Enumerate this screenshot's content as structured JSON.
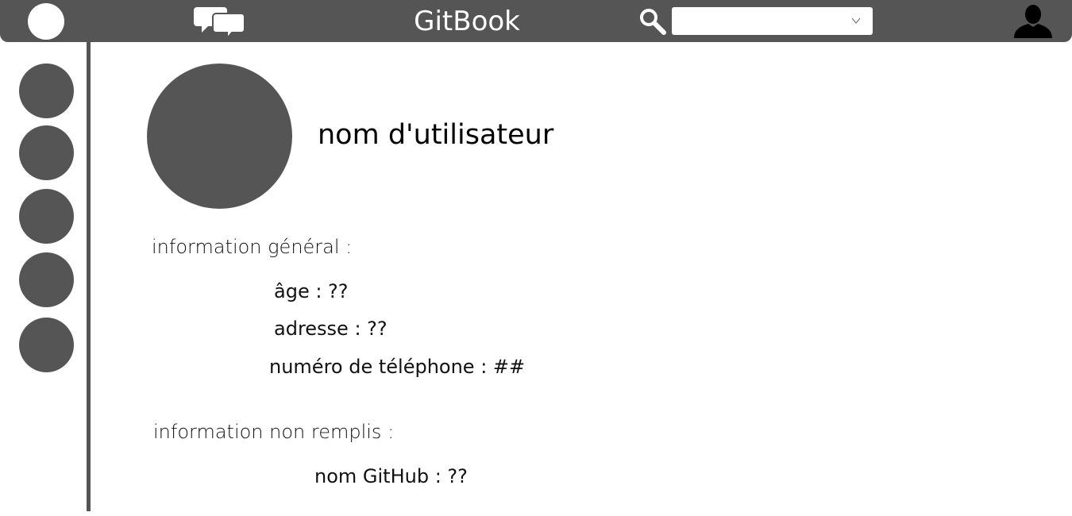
{
  "header": {
    "title": "GitBook",
    "search": {
      "value": "",
      "placeholder": ""
    },
    "icons": {
      "home": "home-circle-icon",
      "chat": "chat-bubbles-icon",
      "search": "search-icon",
      "dropdown": "chevron-down-icon",
      "user": "user-silhouette-icon"
    }
  },
  "sidebar": {
    "items": [
      {
        "icon": "circle-icon"
      },
      {
        "icon": "circle-icon"
      },
      {
        "icon": "circle-icon"
      },
      {
        "icon": "circle-icon"
      },
      {
        "icon": "circle-icon"
      }
    ]
  },
  "profile": {
    "username": "nom d'utilisateur",
    "general_heading": "information général :",
    "age": "âge : ??",
    "address": "adresse : ??",
    "phone": "numéro de téléphone : ##",
    "missing_heading": "information non remplis :",
    "github": "nom GitHub : ??"
  },
  "colors": {
    "bar": "#555555",
    "background": "#ffffff",
    "text": "#111111"
  }
}
